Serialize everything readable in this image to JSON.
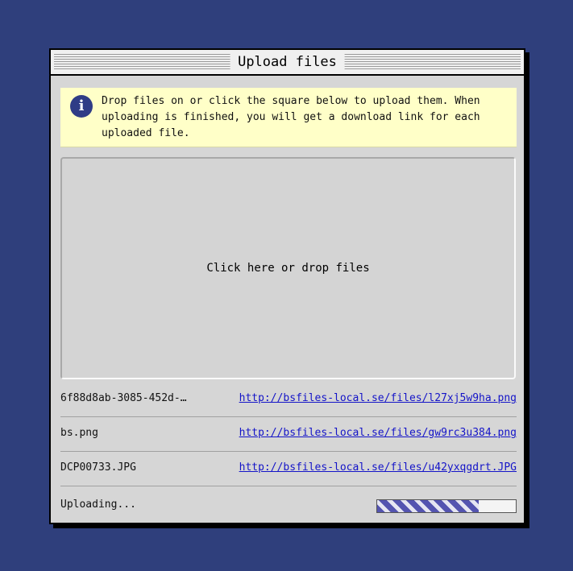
{
  "window": {
    "title": "Upload files"
  },
  "info": {
    "icon": "info-icon",
    "text": "Drop files on or click the square below to upload them. When uploading is finished, you will get a download link for each uploaded file."
  },
  "dropzone": {
    "label": "Click here or drop files"
  },
  "files": [
    {
      "name": "6f88d8ab-3085-452d-…",
      "link": "http://bsfiles-local.se/files/l27xj5w9ha.png"
    },
    {
      "name": "bs.png",
      "link": "http://bsfiles-local.se/files/gw9rc3u384.png"
    },
    {
      "name": "DCP00733.JPG",
      "link": "http://bsfiles-local.se/files/u42yxqgdrt.JPG"
    }
  ],
  "upload": {
    "status": "Uploading...",
    "progress": 0.73
  },
  "colors": {
    "background": "#2f3f7c",
    "info_bg": "#ffffc8",
    "link": "#1414c8",
    "progress": "#5454b0"
  }
}
